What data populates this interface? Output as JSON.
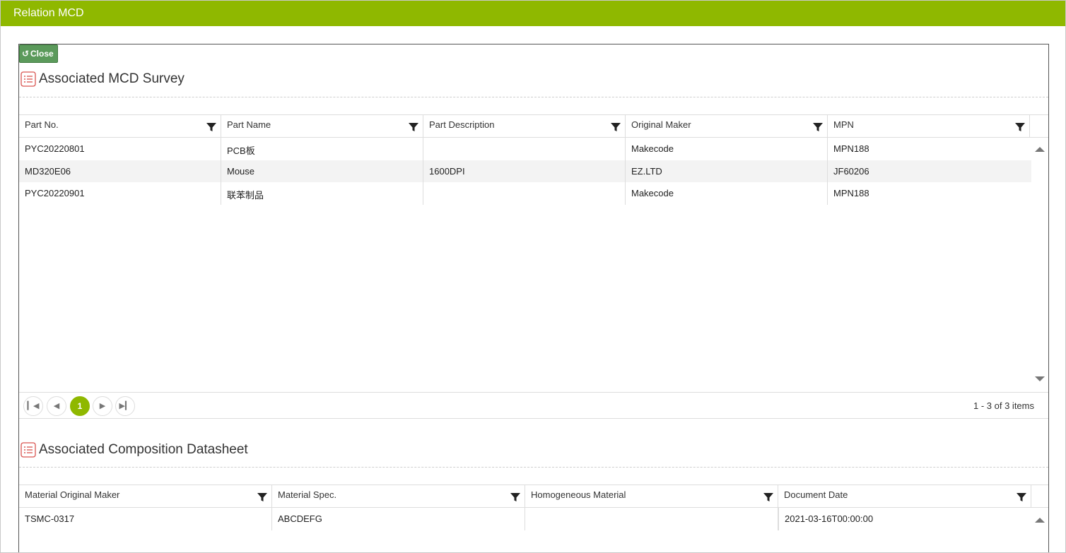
{
  "window": {
    "title": "Relation MCD"
  },
  "toolbar": {
    "close_label": "Close"
  },
  "survey": {
    "title": "Associated MCD Survey",
    "columns": [
      "Part No.",
      "Part Name",
      "Part Description",
      "Original Maker",
      "MPN"
    ],
    "rows": [
      [
        "PYC20220801",
        "PCB板",
        "",
        "Makecode",
        "MPN188"
      ],
      [
        "MD320E06",
        "Mouse",
        "1600DPI",
        "EZ.LTD",
        "JF60206"
      ],
      [
        "PYC20220901",
        "联苯制品",
        "",
        "Makecode",
        "MPN188"
      ]
    ],
    "pager": {
      "current_page": "1",
      "info": "1 - 3 of 3 items"
    }
  },
  "datasheet": {
    "title": "Associated Composition Datasheet",
    "columns": [
      "Material Original Maker",
      "Material Spec.",
      "Homogeneous Material",
      "Document Date"
    ],
    "rows": [
      [
        "TSMC-0317",
        "ABCDEFG",
        "",
        "2021-03-16T00:00:00"
      ]
    ]
  },
  "icons": {
    "close": "undo-icon",
    "section": "list-icon",
    "filter": "filter-icon",
    "pager_first": "first-page-icon",
    "pager_prev": "prev-page-icon",
    "pager_next": "next-page-icon",
    "pager_last": "last-page-icon"
  },
  "colors": {
    "titlebar": "#8fb800",
    "close_button": "#5b9a5b",
    "active_page": "#8fb800",
    "section_icon": "#d9534f"
  }
}
